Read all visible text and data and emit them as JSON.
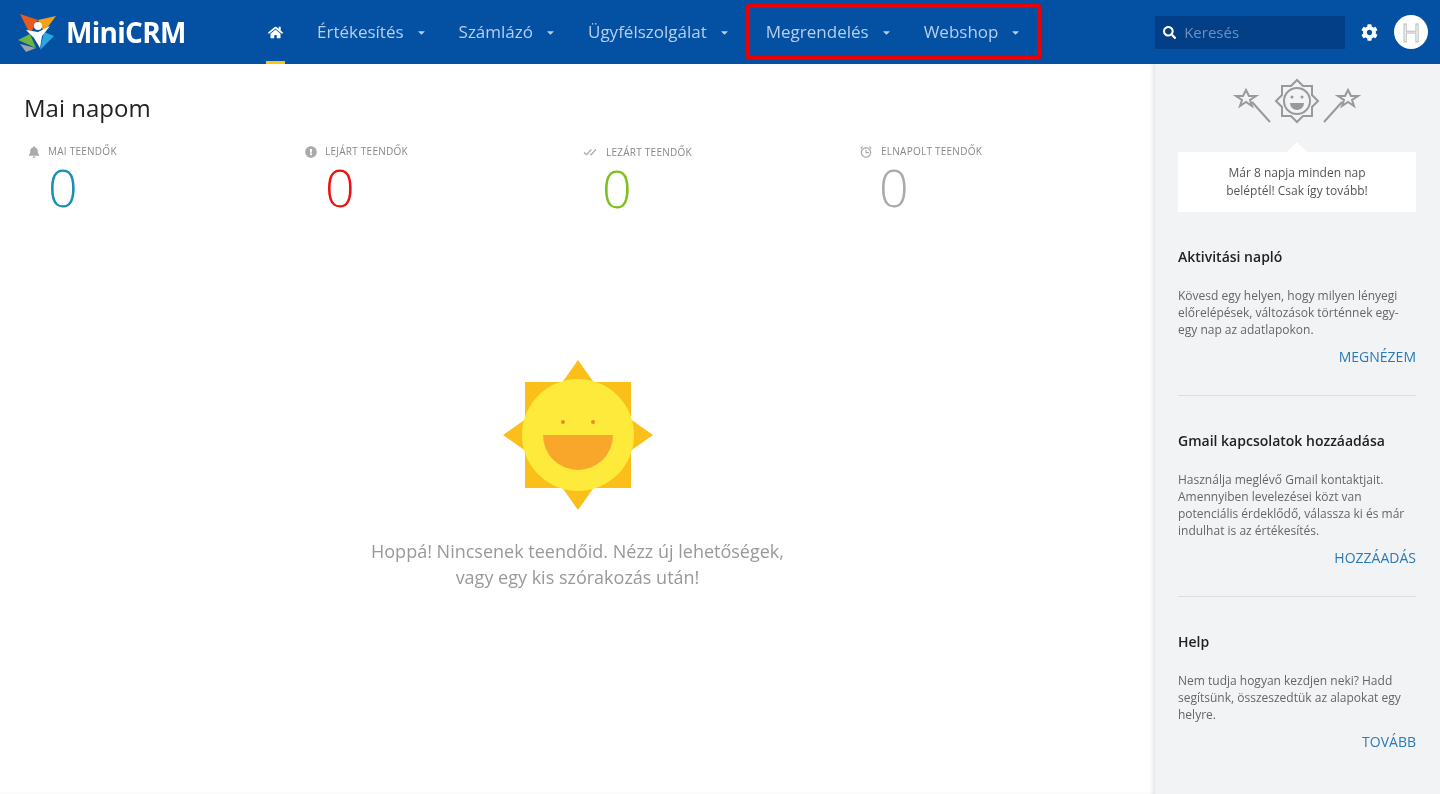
{
  "brand": {
    "name": "MiniCRM"
  },
  "nav": [
    {
      "kind": "home",
      "selected": true,
      "highlighted": false
    },
    {
      "kind": "menu",
      "label": "Értékesítés",
      "selected": false,
      "highlighted": false
    },
    {
      "kind": "menu",
      "label": "Számlázó",
      "selected": false,
      "highlighted": false
    },
    {
      "kind": "menu",
      "label": "Ügyfélszolgálat",
      "selected": false,
      "highlighted": false
    },
    {
      "kind": "menu",
      "label": "Megrendelés",
      "selected": false,
      "highlighted": true
    },
    {
      "kind": "menu",
      "label": "Webshop",
      "selected": false,
      "highlighted": true
    }
  ],
  "search": {
    "placeholder": "Keresés"
  },
  "avatar": {
    "initial": "H"
  },
  "page": {
    "title": "Mai napom"
  },
  "stats": [
    {
      "kind": "bell",
      "label": "MAI TEENDŐK",
      "value": "0",
      "color": "#1a8fb5"
    },
    {
      "kind": "alert",
      "label": "LEJÁRT TEENDŐK",
      "value": "0",
      "color": "#ee1111"
    },
    {
      "kind": "done",
      "label": "LEZÁRT TEENDŐK",
      "value": "0",
      "color": "#7cc11c"
    },
    {
      "kind": "clock",
      "label": "ELNAPOLT TEENDŐK",
      "value": "0",
      "color": "#aaaaaa"
    }
  ],
  "empty_message": "Hoppá! Nincsenek teendőid. Nézz új lehetőségek, vagy egy kis szórakozás után!",
  "streak": {
    "text": "Már 8 napja minden nap beléptél! Csak így tovább!"
  },
  "cards": [
    {
      "title": "Aktivitási napló",
      "text": "Kövesd egy helyen, hogy milyen lényegi előrelépések, változások történnek egy-egy nap az adatlapokon.",
      "link": "MEGNÉZEM"
    },
    {
      "title": "Gmail kapcsolatok hozzáadása",
      "text": "Használja meglévő Gmail kontaktjait. Amennyiben levelezései közt van potenciális érdeklődő, válassza ki és már indulhat is az értékesítés.",
      "link": "HOZZÁADÁS"
    },
    {
      "title": "Help",
      "text": "Nem tudja hogyan kezdjen neki? Hadd segítsünk, összeszedtük az alapokat egy helyre.",
      "link": "TOVÁBB"
    }
  ]
}
